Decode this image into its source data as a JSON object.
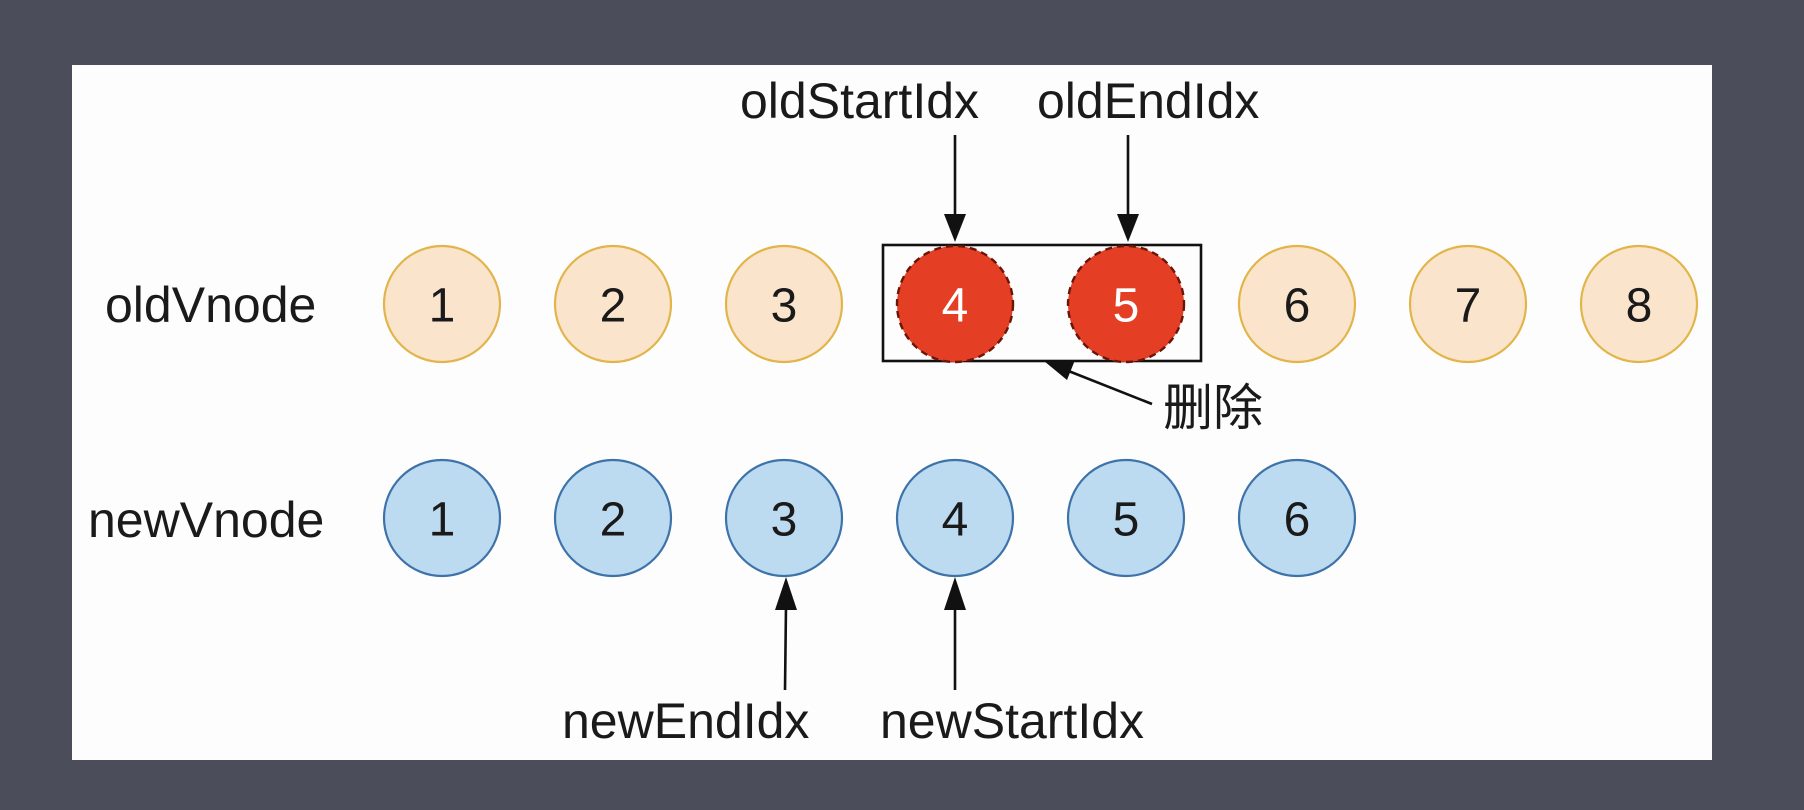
{
  "colors": {
    "page_bg": "#4b4d5a",
    "panel_bg": "#fdfdfd",
    "old_fill": "#fbe4cc",
    "old_stroke": "#e2b54b",
    "deleted_fill": "#e43f25",
    "deleted_stroke": "#6b1408",
    "new_fill": "#bcdaf0",
    "new_stroke": "#3d73a8",
    "text": "#1a1a1a",
    "deleted_text": "#ffffff"
  },
  "rows": {
    "old_label": "oldVnode",
    "new_label": "newVnode"
  },
  "old_nodes": [
    {
      "label": "1",
      "state": "normal"
    },
    {
      "label": "2",
      "state": "normal"
    },
    {
      "label": "3",
      "state": "normal"
    },
    {
      "label": "4",
      "state": "deleted"
    },
    {
      "label": "5",
      "state": "deleted"
    },
    {
      "label": "6",
      "state": "normal"
    },
    {
      "label": "7",
      "state": "normal"
    },
    {
      "label": "8",
      "state": "normal"
    }
  ],
  "new_nodes": [
    {
      "label": "1"
    },
    {
      "label": "2"
    },
    {
      "label": "3"
    },
    {
      "label": "4"
    },
    {
      "label": "5"
    },
    {
      "label": "6"
    }
  ],
  "pointers": {
    "old_start": {
      "label": "oldStartIdx",
      "target_index": 3
    },
    "old_end": {
      "label": "oldEndIdx",
      "target_index": 4
    },
    "new_end": {
      "label": "newEndIdx",
      "target_index": 2
    },
    "new_start": {
      "label": "newStartIdx",
      "target_index": 3
    }
  },
  "delete_note": "删除"
}
